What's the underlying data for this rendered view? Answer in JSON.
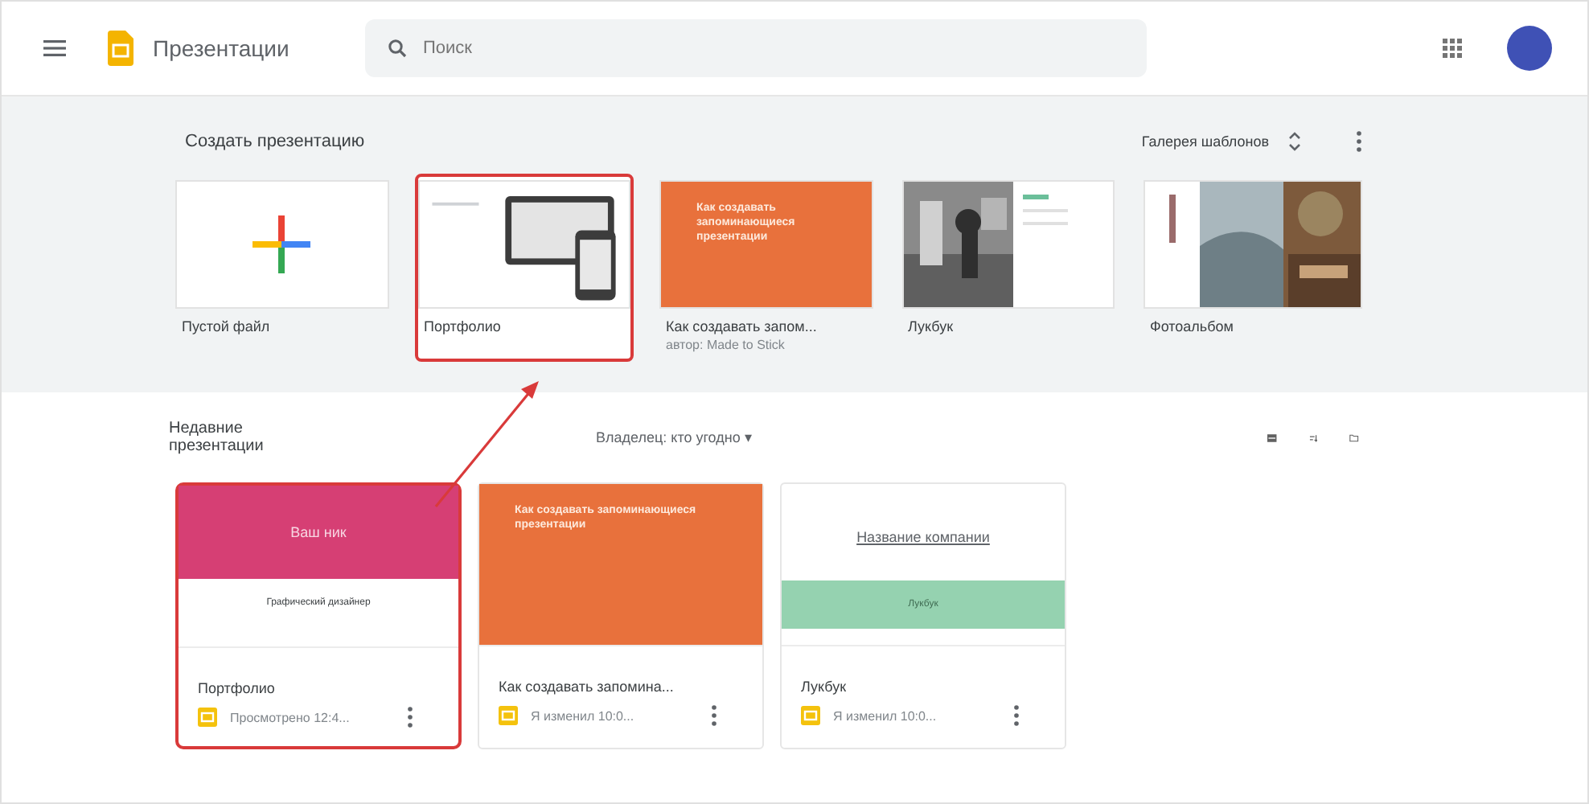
{
  "app": {
    "title": "Презентации"
  },
  "search": {
    "placeholder": "Поиск"
  },
  "templates": {
    "heading": "Создать презентацию",
    "gallery": "Галерея шаблонов",
    "items": [
      {
        "kind": "blank",
        "caption": "Пустой файл",
        "highlighted": false
      },
      {
        "kind": "portfolio",
        "caption": "Портфолио",
        "highlighted": true
      },
      {
        "kind": "orange",
        "caption": "Как создавать запом...",
        "subcaption": "автор: Made to Stick",
        "thumb_text": "Как создавать запоминающиеся презентации",
        "highlighted": false
      },
      {
        "kind": "lookbook",
        "caption": "Лукбук",
        "highlighted": false
      },
      {
        "kind": "album",
        "caption": "Фотоальбом",
        "highlighted": false
      }
    ]
  },
  "recent": {
    "heading": "Недавние презентации",
    "owner_filter": "Владелец: кто угодно ▾",
    "items": [
      {
        "kind": "resume",
        "title": "Портфолио",
        "meta": "Просмотрено 12:4...",
        "thumb_title": "Ваш ник",
        "thumb_subtitle": "Графический дизайнер",
        "highlighted": true
      },
      {
        "kind": "orange",
        "title": "Как создавать запомина...",
        "meta": "Я изменил 10:0...",
        "thumb_title": "Как создавать запоминающиеся презентации",
        "highlighted": false
      },
      {
        "kind": "green",
        "title": "Лукбук",
        "meta": "Я изменил 10:0...",
        "thumb_title": "Название компании",
        "thumb_subtitle": "Лукбук",
        "highlighted": false
      }
    ]
  },
  "annotation_arrow": true
}
